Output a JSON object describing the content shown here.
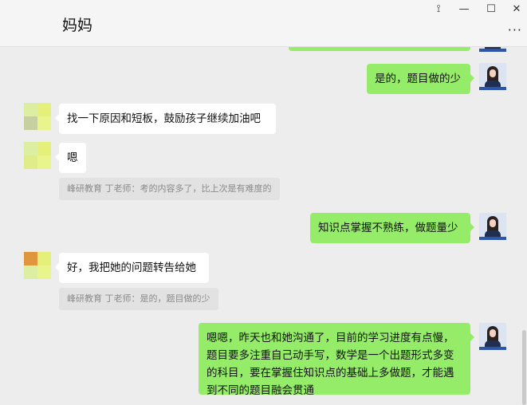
{
  "window": {
    "title": "妈妈",
    "pin_icon": "⟟",
    "minimize_icon": "—",
    "maximize_icon": "☐",
    "close_icon": "✕",
    "more_icon": "···"
  },
  "colors": {
    "outgoing_bubble": "#95ec69",
    "incoming_bubble": "#ffffff",
    "chat_background": "#ededed"
  },
  "messages": [
    {
      "direction": "out",
      "text": "是的，题目做的少"
    },
    {
      "direction": "in",
      "text": "找一下原因和短板，鼓励孩子继续加油吧"
    },
    {
      "direction": "in",
      "text": "嗯",
      "quote": "峰研教育 丁老师：考的内容多了，比上次是有难度的"
    },
    {
      "direction": "out",
      "text": "知识点掌握不熟练，做题量少"
    },
    {
      "direction": "in",
      "text": "好，我把她的问题转告给她",
      "quote": "峰研教育 丁老师：是的，题目做的少"
    },
    {
      "direction": "out",
      "text": "嗯嗯，昨天也和她沟通了，目前的学习进度有点慢，题目要多注重自己动手写，数学是一个出题形式多变的科目，要在掌握住知识点的基础上多做题，才能遇到不同的题目融会贯通"
    }
  ]
}
